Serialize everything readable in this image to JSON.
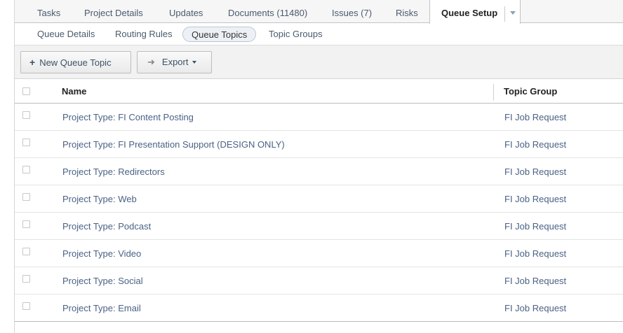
{
  "tabs": {
    "items": [
      {
        "label": "Tasks"
      },
      {
        "label": "Project Details"
      },
      {
        "label": "Updates"
      },
      {
        "label": "Documents (11480)"
      },
      {
        "label": "Issues (7)"
      },
      {
        "label": "Risks"
      },
      {
        "label": "Queue Setup"
      }
    ],
    "active": "Queue Setup"
  },
  "subtabs": {
    "items": [
      {
        "label": "Queue Details"
      },
      {
        "label": "Routing Rules"
      },
      {
        "label": "Queue Topics"
      },
      {
        "label": "Topic Groups"
      }
    ],
    "active": "Queue Topics"
  },
  "toolbar": {
    "new_label": "New Queue Topic",
    "export_label": "Export",
    "new_icon": "plus-icon",
    "export_icon": "arrow-right-icon"
  },
  "table": {
    "columns": [
      "Name",
      "Topic Group"
    ],
    "rows": [
      {
        "name": "Project Type: FI Content Posting",
        "group": "FI Job Request"
      },
      {
        "name": "Project Type: FI Presentation Support (DESIGN ONLY)",
        "group": "FI Job Request"
      },
      {
        "name": "Project Type: Redirectors",
        "group": "FI Job Request"
      },
      {
        "name": "Project Type: Web",
        "group": "FI Job Request"
      },
      {
        "name": "Project Type: Podcast",
        "group": "FI Job Request"
      },
      {
        "name": "Project Type: Video",
        "group": "FI Job Request"
      },
      {
        "name": "Project Type: Social",
        "group": "FI Job Request"
      },
      {
        "name": "Project Type: Email",
        "group": "FI Job Request"
      }
    ]
  },
  "colors": {
    "link": "#4a6285",
    "border": "#c4c4c4",
    "active_subtab_bg": "#edf1f6"
  }
}
